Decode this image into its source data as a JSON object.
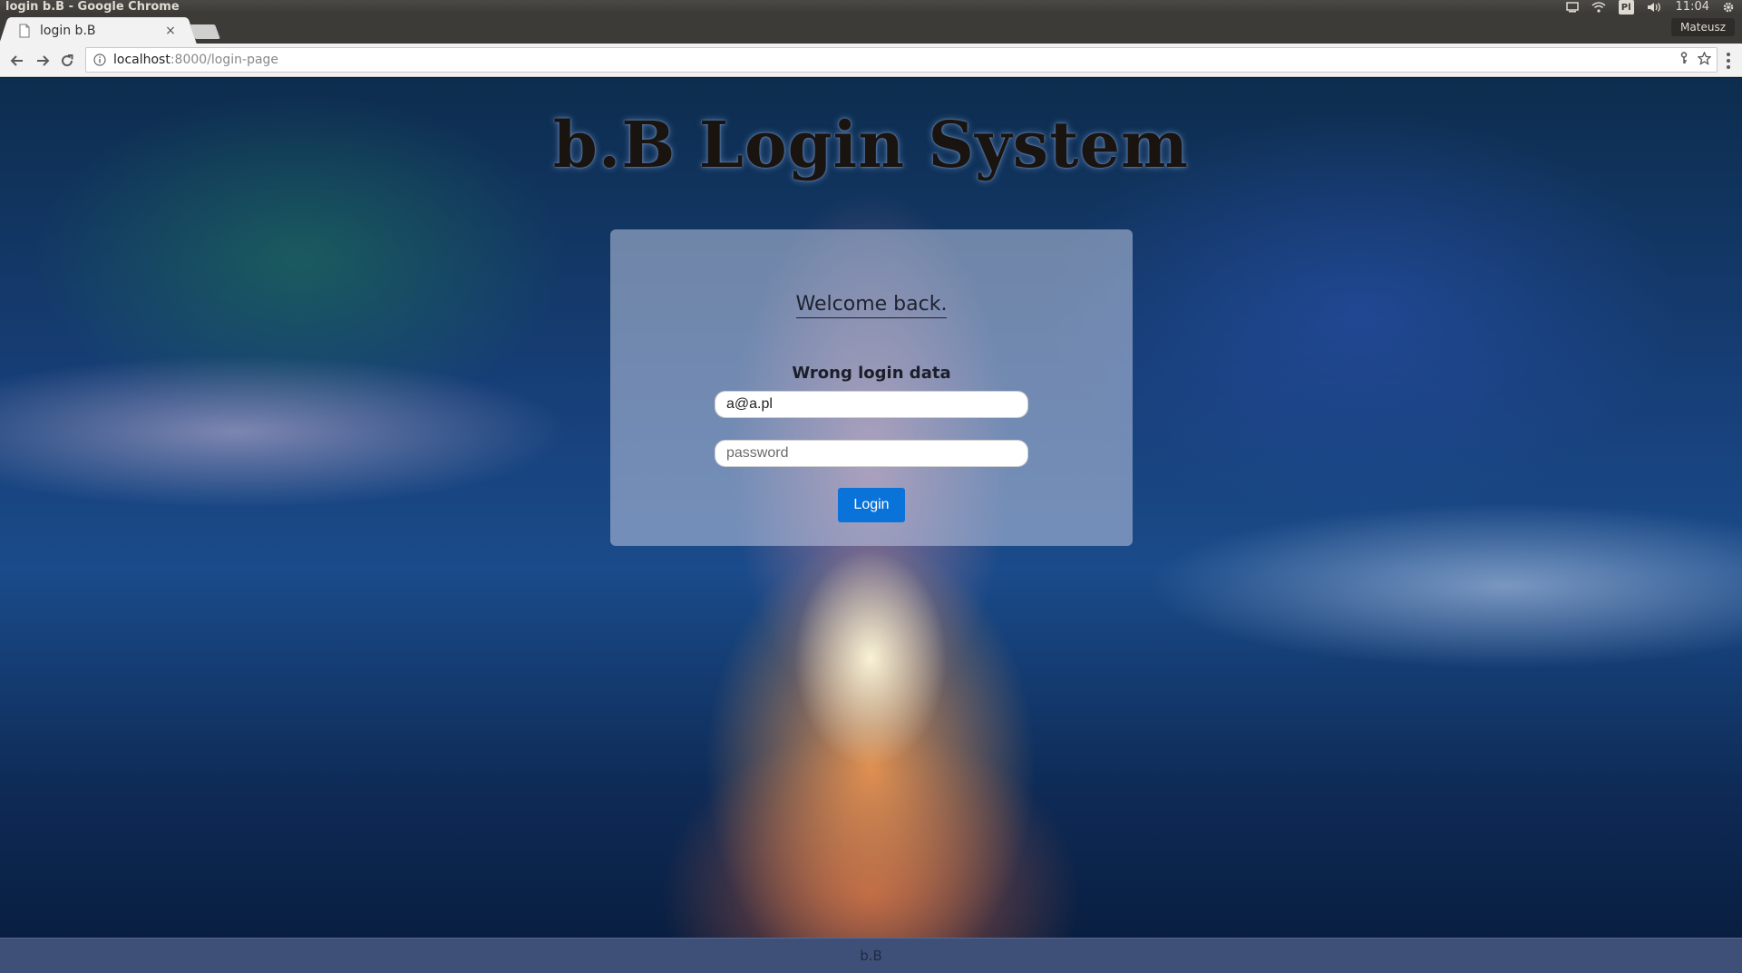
{
  "os": {
    "window_title": "login b.B - Google Chrome",
    "keyboard_layout": "Pl",
    "time": "11:04",
    "tray_icons": [
      "network-wired-icon",
      "wifi-icon",
      "keyboard-icon",
      "volume-icon",
      "settings-gear-icon"
    ]
  },
  "browser": {
    "tab_title": "login b.B",
    "tab_close": "×",
    "profile_name": "Mateusz",
    "url_host": "localhost",
    "url_rest": ":8000/login-page"
  },
  "page": {
    "heading": "b.B Login System",
    "welcome": "Welcome back.",
    "error": "Wrong login data",
    "email_value": "a@a.pl",
    "password_placeholder": "password",
    "login_label": "Login",
    "footer": "b.B"
  },
  "colors": {
    "button": "#0a73d9",
    "footer_bg": "#3e5078"
  }
}
